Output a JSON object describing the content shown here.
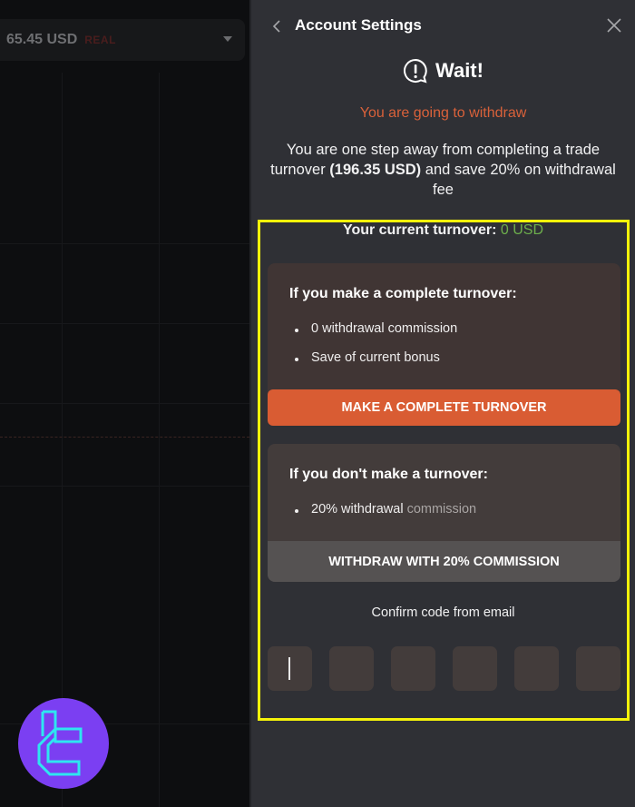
{
  "background": {
    "balance": {
      "amount": "65.45 USD",
      "account_type": "REAL"
    },
    "logo": {
      "name": "brand-logo",
      "color": "#7b3ff2",
      "glyph_color": "#2ee6f0"
    }
  },
  "panel": {
    "header": {
      "title": "Account Settings",
      "back_icon": "chevron-left-icon",
      "close_icon": "close-icon"
    },
    "wait": {
      "icon": "alert-bubble-icon",
      "title": "Wait!"
    },
    "subtitle": "You are going to withdraw",
    "description": {
      "before": "You are one step away from completing a trade turnover ",
      "amount": "(196.35 USD)",
      "after": " and save 20% on withdrawal fee"
    },
    "current_turnover": {
      "label": "Your current turnover: ",
      "value": "0 USD"
    },
    "option_complete": {
      "title": "If you make a complete turnover:",
      "items": [
        "0 withdrawal commission",
        "Save of current bonus"
      ],
      "button": "MAKE A COMPLETE TURNOVER"
    },
    "option_no_turnover": {
      "title": "If you don't make a turnover:",
      "item_main": "20% withdrawal",
      "item_muted": "commission",
      "button": "WITHDRAW WITH 20% COMMISSION"
    },
    "confirm": {
      "label": "Confirm code from email",
      "digits": [
        "",
        "",
        "",
        "",
        "",
        ""
      ]
    }
  },
  "colors": {
    "accent": "#d9613a",
    "success": "#6dae4c",
    "highlight": "#f4f20a",
    "panel_bg": "#2f3035"
  }
}
